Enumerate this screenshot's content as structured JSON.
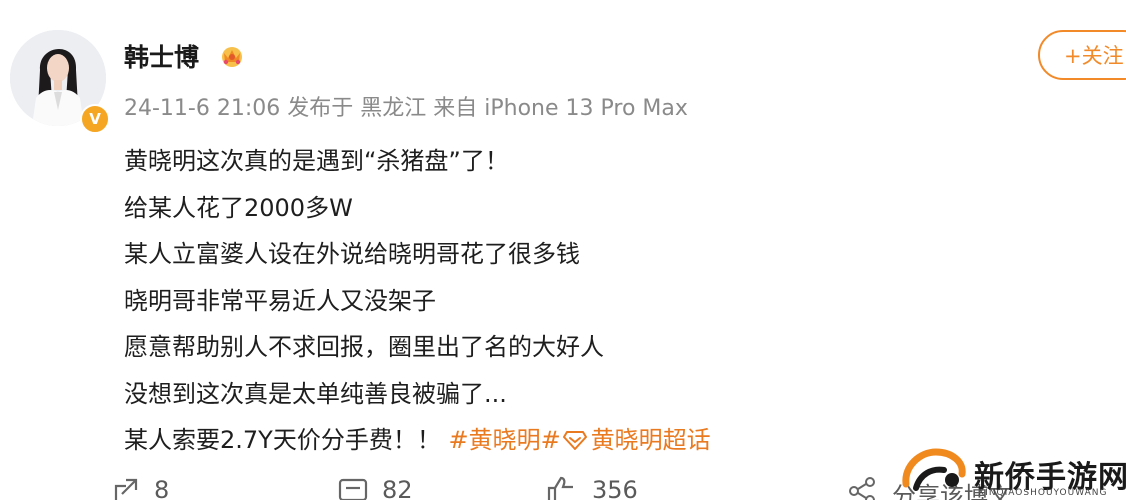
{
  "post": {
    "author": {
      "name": "韩士博",
      "verified_mark": "V"
    },
    "meta": {
      "date": "24-11-6 21:06",
      "location": "发布于 黑龙江",
      "source": "来自 iPhone 13 Pro Max"
    },
    "follow_label": "+关注",
    "content": {
      "lines": [
        "黄晓明这次真的是遇到“杀猪盘”了！",
        "给某人花了2000多W",
        "某人立富婆人设在外说给晓明哥花了很多钱",
        "晓明哥非常平易近人又没架子",
        "愿意帮助别人不求回报，圈里出了名的大好人",
        "没想到这次真是太单纯善良被骗了..."
      ],
      "last_line_text": "某人索要2.7Y天价分手费！！",
      "hashtag": "#黄晓明#",
      "super_topic": "黄晓明超话"
    },
    "actions": {
      "repost_count": "8",
      "comment_count": "82",
      "like_count": "356"
    }
  },
  "watermark": {
    "text": "新侨手游网",
    "subtext": "XINQIAOSHOUYOUWANG",
    "overlap_text": "分享该博文"
  },
  "colors": {
    "accent": "#f28a2a",
    "hashtag": "#ea7a1f",
    "meta_gray": "#8a8a8a",
    "verified": "#f5a623"
  }
}
